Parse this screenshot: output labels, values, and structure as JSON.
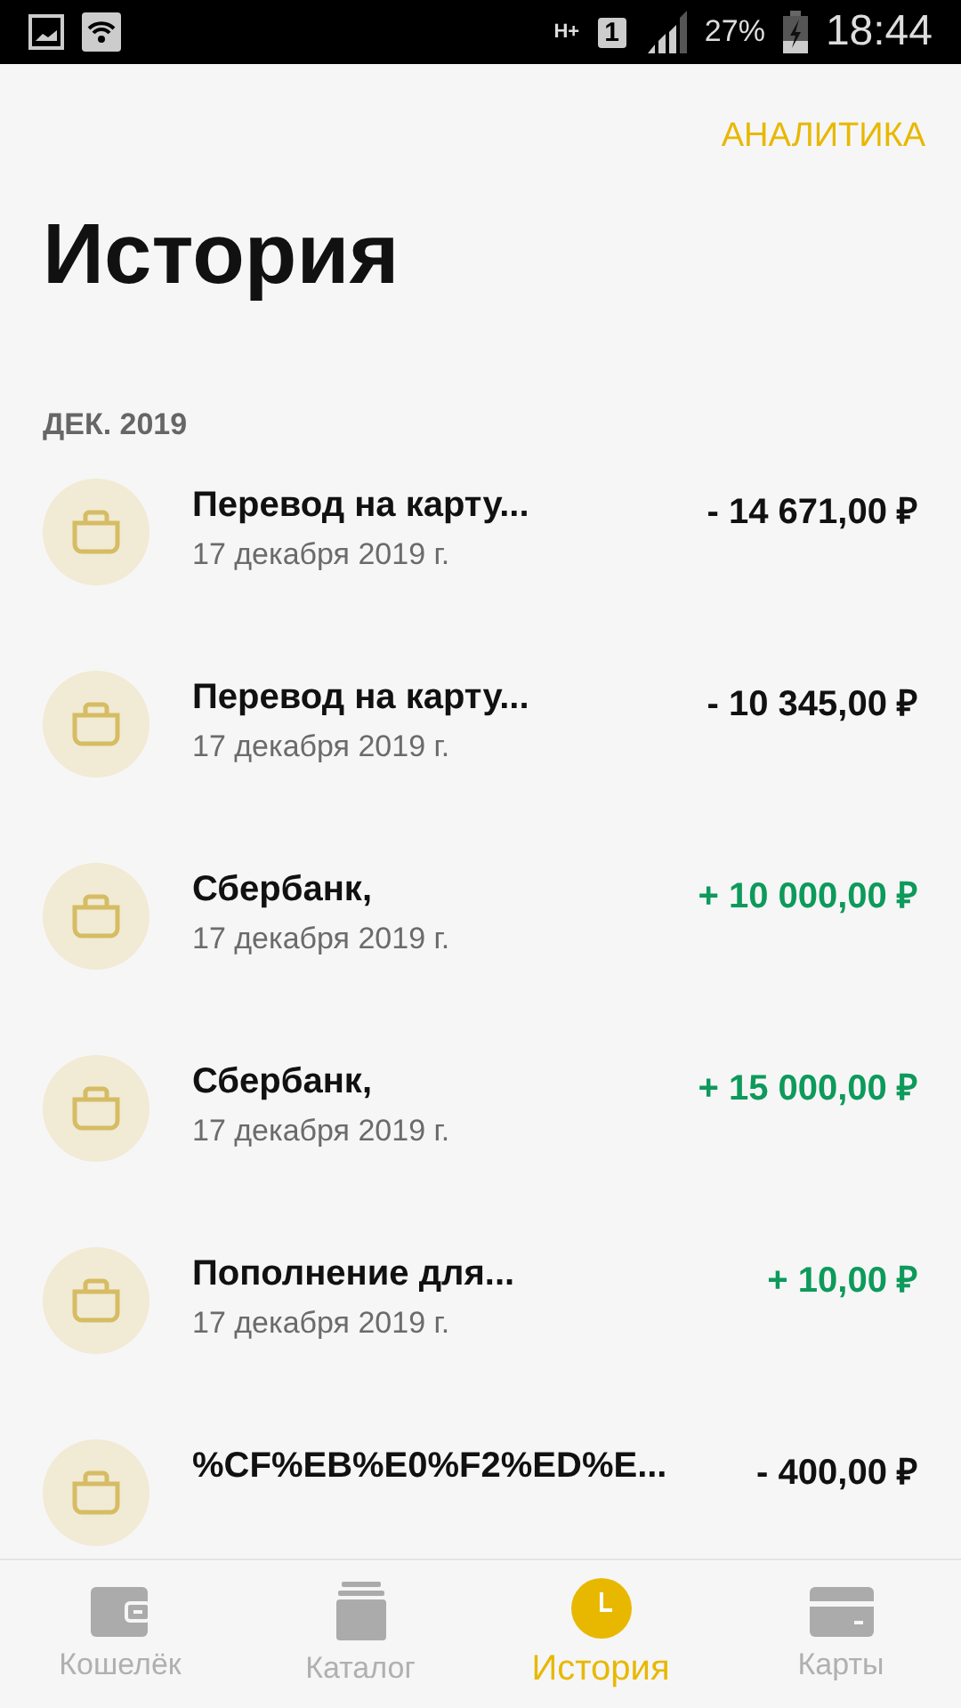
{
  "status_bar": {
    "network": "H+",
    "sim": "1",
    "battery": "27%",
    "time": "18:44"
  },
  "header": {
    "action": "АНАЛИТИКА",
    "title": "История"
  },
  "month": "ДЕК. 2019",
  "transactions": [
    {
      "title": "Перевод на карту...",
      "date": "17 декабря 2019 г.",
      "amount": "- 14 671,00 ₽",
      "kind": "debit"
    },
    {
      "title": "Перевод на карту...",
      "date": "17 декабря 2019 г.",
      "amount": "- 10 345,00 ₽",
      "kind": "debit"
    },
    {
      "title": "Сбербанк,",
      "date": "17 декабря 2019 г.",
      "amount": "+ 10 000,00 ₽",
      "kind": "credit"
    },
    {
      "title": "Сбербанк,",
      "date": "17 декабря 2019 г.",
      "amount": "+ 15 000,00 ₽",
      "kind": "credit"
    },
    {
      "title": "Пополнение для...",
      "date": "17 декабря 2019 г.",
      "amount": "+ 10,00 ₽",
      "kind": "credit"
    },
    {
      "title": "%CF%EB%E0%F2%ED%E...",
      "amount": "- 400,00 ₽",
      "kind": "debit"
    }
  ],
  "bottom_nav": [
    {
      "label": "Кошелёк",
      "kind": "wallet",
      "selected": false
    },
    {
      "label": "Каталог",
      "kind": "catalog",
      "selected": false
    },
    {
      "label": "История",
      "kind": "clock",
      "selected": true
    },
    {
      "label": "Карты",
      "kind": "card",
      "selected": false
    }
  ]
}
